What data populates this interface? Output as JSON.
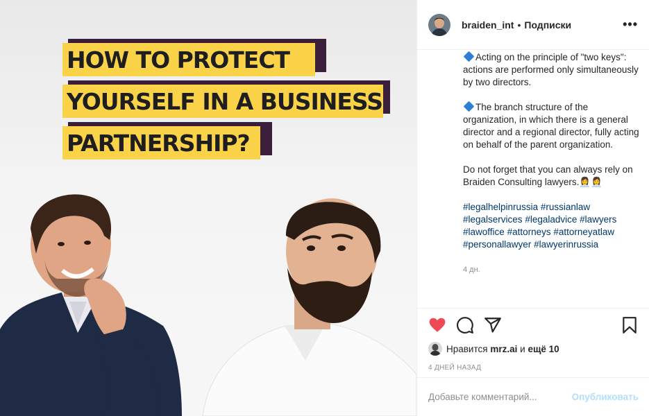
{
  "post_image": {
    "headline_lines": [
      "HOW TO PROTECT",
      "YOURSELF IN A BUSINESS",
      "PARTNERSHIP?"
    ],
    "colors": {
      "highlight": "#fbd349",
      "shadow": "#3b1f3a"
    }
  },
  "header": {
    "username": "braiden_int",
    "separator": "•",
    "follow_label": "Подписки",
    "more_label": "•••"
  },
  "caption": {
    "paragraph_1": "Acting on the principle of \"two keys\": actions are performed only simultaneously by two directors.",
    "paragraph_2": "The branch structure of the organization, in which there is a general director and a regional director, fully acting on behalf of the parent organization.",
    "paragraph_3": "Do not forget that you can always rely on Braiden Consulting lawyers.",
    "emoji": "👩‍💼👩‍💼",
    "hashtags": [
      "#legalhelpinrussia",
      "#russianlaw",
      "#legalservices",
      "#legaladvice",
      "#lawyers",
      "#lawoffice",
      "#attorneys",
      "#attorneyatlaw",
      "#personallawyer",
      "#lawyerinrussia"
    ],
    "age": "4 дн."
  },
  "actions": {
    "icons": [
      "heart-icon",
      "comment-icon",
      "share-icon",
      "bookmark-icon"
    ],
    "liked": true,
    "likes_prefix": "Нравится",
    "likes_user": "mrz.ai",
    "likes_mid": "и",
    "likes_count": "ещё 10",
    "posted_ago": "4 ДНЕЙ НАЗАД"
  },
  "comment": {
    "placeholder": "Добавьте комментарий...",
    "publish_label": "Опубликовать"
  },
  "colors": {
    "like_red": "#ed4956",
    "hashtag_blue": "#00376b",
    "publish_disabled": "#b2dffc",
    "muted": "#8e8e8e"
  }
}
